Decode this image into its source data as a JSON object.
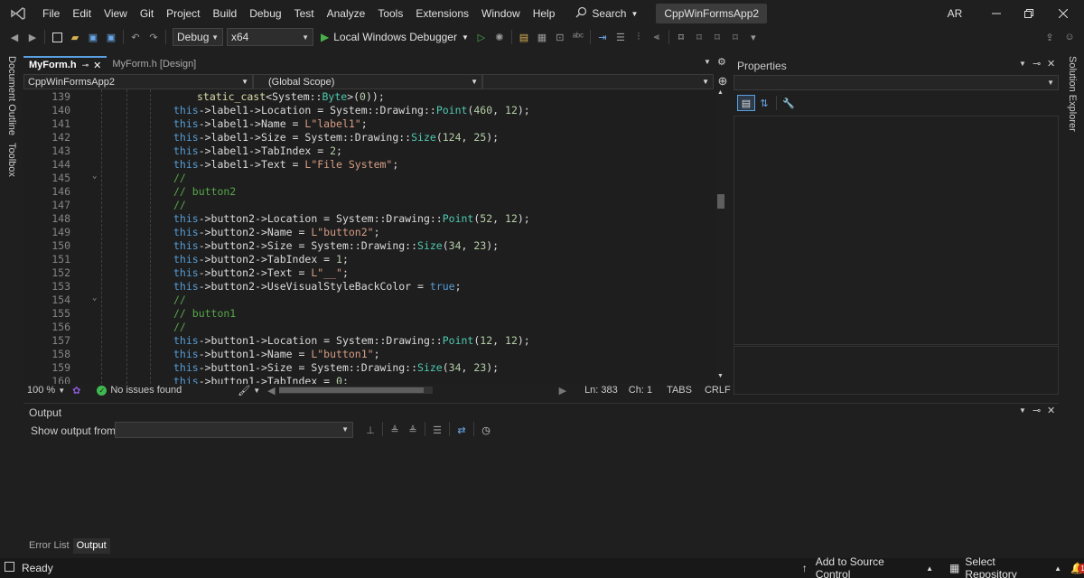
{
  "window": {
    "project_name": "CppWinFormsApp2",
    "avatar_initials": "AR"
  },
  "menu": [
    "File",
    "Edit",
    "View",
    "Git",
    "Project",
    "Build",
    "Debug",
    "Test",
    "Analyze",
    "Tools",
    "Extensions",
    "Window",
    "Help"
  ],
  "search": {
    "label": "Search"
  },
  "toolbar": {
    "config": "Debug",
    "platform": "x64",
    "debugger": "Local Windows Debugger"
  },
  "leftbar": {
    "document_outline": "Document Outline",
    "toolbox": "Toolbox"
  },
  "rightbar": {
    "solution_explorer": "Solution Explorer"
  },
  "editor": {
    "tabs": [
      "MyForm.h",
      "MyForm.h [Design]"
    ],
    "active_tab_pin": "ꟼ",
    "nav_project": "CppWinFormsApp2",
    "nav_scope": "(Global Scope)",
    "lines": [
      {
        "n": "139",
        "indent": 1,
        "t": [
          [
            "fn",
            "static_cast"
          ],
          [
            "id",
            "<System::"
          ],
          [
            "ty",
            "Byte"
          ],
          [
            "id",
            ">("
          ],
          [
            "num",
            "0"
          ],
          [
            "id",
            "));"
          ]
        ]
      },
      {
        "n": "140",
        "t": [
          [
            "kw",
            "this"
          ],
          [
            "id",
            "->label1->Location = System::Drawing::"
          ],
          [
            "ty",
            "Point"
          ],
          [
            "id",
            "("
          ],
          [
            "num",
            "460"
          ],
          [
            "id",
            ", "
          ],
          [
            "num",
            "12"
          ],
          [
            "id",
            ");"
          ]
        ]
      },
      {
        "n": "141",
        "t": [
          [
            "kw",
            "this"
          ],
          [
            "id",
            "->label1->Name = "
          ],
          [
            "str",
            "L\"label1\""
          ],
          [
            "id",
            ";"
          ]
        ]
      },
      {
        "n": "142",
        "t": [
          [
            "kw",
            "this"
          ],
          [
            "id",
            "->label1->Size = System::Drawing::"
          ],
          [
            "ty",
            "Size"
          ],
          [
            "id",
            "("
          ],
          [
            "num",
            "124"
          ],
          [
            "id",
            ", "
          ],
          [
            "num",
            "25"
          ],
          [
            "id",
            ");"
          ]
        ]
      },
      {
        "n": "143",
        "t": [
          [
            "kw",
            "this"
          ],
          [
            "id",
            "->label1->TabIndex = "
          ],
          [
            "num",
            "2"
          ],
          [
            "id",
            ";"
          ]
        ]
      },
      {
        "n": "144",
        "t": [
          [
            "kw",
            "this"
          ],
          [
            "id",
            "->label1->Text = "
          ],
          [
            "str",
            "L\"File System\""
          ],
          [
            "id",
            ";"
          ]
        ]
      },
      {
        "n": "145",
        "t": [
          [
            "cm",
            "//"
          ]
        ]
      },
      {
        "n": "146",
        "t": [
          [
            "cm",
            "// button2"
          ]
        ]
      },
      {
        "n": "147",
        "t": [
          [
            "cm",
            "//"
          ]
        ]
      },
      {
        "n": "148",
        "t": [
          [
            "kw",
            "this"
          ],
          [
            "id",
            "->button2->Location = System::Drawing::"
          ],
          [
            "ty",
            "Point"
          ],
          [
            "id",
            "("
          ],
          [
            "num",
            "52"
          ],
          [
            "id",
            ", "
          ],
          [
            "num",
            "12"
          ],
          [
            "id",
            ");"
          ]
        ]
      },
      {
        "n": "149",
        "t": [
          [
            "kw",
            "this"
          ],
          [
            "id",
            "->button2->Name = "
          ],
          [
            "str",
            "L\"button2\""
          ],
          [
            "id",
            ";"
          ]
        ]
      },
      {
        "n": "150",
        "t": [
          [
            "kw",
            "this"
          ],
          [
            "id",
            "->button2->Size = System::Drawing::"
          ],
          [
            "ty",
            "Size"
          ],
          [
            "id",
            "("
          ],
          [
            "num",
            "34"
          ],
          [
            "id",
            ", "
          ],
          [
            "num",
            "23"
          ],
          [
            "id",
            ");"
          ]
        ]
      },
      {
        "n": "151",
        "t": [
          [
            "kw",
            "this"
          ],
          [
            "id",
            "->button2->TabIndex = "
          ],
          [
            "num",
            "1"
          ],
          [
            "id",
            ";"
          ]
        ]
      },
      {
        "n": "152",
        "t": [
          [
            "kw",
            "this"
          ],
          [
            "id",
            "->button2->Text = "
          ],
          [
            "str",
            "L\"__\""
          ],
          [
            "id",
            ";"
          ]
        ]
      },
      {
        "n": "153",
        "t": [
          [
            "kw",
            "this"
          ],
          [
            "id",
            "->button2->UseVisualStyleBackColor = "
          ],
          [
            "kw",
            "true"
          ],
          [
            "id",
            ";"
          ]
        ]
      },
      {
        "n": "154",
        "t": [
          [
            "cm",
            "//"
          ]
        ]
      },
      {
        "n": "155",
        "t": [
          [
            "cm",
            "// button1"
          ]
        ]
      },
      {
        "n": "156",
        "t": [
          [
            "cm",
            "//"
          ]
        ]
      },
      {
        "n": "157",
        "t": [
          [
            "kw",
            "this"
          ],
          [
            "id",
            "->button1->Location = System::Drawing::"
          ],
          [
            "ty",
            "Point"
          ],
          [
            "id",
            "("
          ],
          [
            "num",
            "12"
          ],
          [
            "id",
            ", "
          ],
          [
            "num",
            "12"
          ],
          [
            "id",
            ");"
          ]
        ]
      },
      {
        "n": "158",
        "t": [
          [
            "kw",
            "this"
          ],
          [
            "id",
            "->button1->Name = "
          ],
          [
            "str",
            "L\"button1\""
          ],
          [
            "id",
            ";"
          ]
        ]
      },
      {
        "n": "159",
        "t": [
          [
            "kw",
            "this"
          ],
          [
            "id",
            "->button1->Size = System::Drawing::"
          ],
          [
            "ty",
            "Size"
          ],
          [
            "id",
            "("
          ],
          [
            "num",
            "34"
          ],
          [
            "id",
            ", "
          ],
          [
            "num",
            "23"
          ],
          [
            "id",
            ");"
          ]
        ]
      },
      {
        "n": "160",
        "t": [
          [
            "kw",
            "this"
          ],
          [
            "id",
            "->button1->TabIndex = "
          ],
          [
            "num",
            "0"
          ],
          [
            "id",
            ";"
          ]
        ]
      }
    ],
    "status": {
      "zoom": "100 %",
      "issues": "No issues found",
      "line": "Ln: 383",
      "col": "Ch: 1",
      "tabs": "TABS",
      "eol": "CRLF"
    }
  },
  "properties": {
    "title": "Properties"
  },
  "output": {
    "title": "Output",
    "show_from_label": "Show output from:"
  },
  "bottom_tabs": [
    "Error List",
    "Output"
  ],
  "statusbar": {
    "ready": "Ready",
    "source_control": "Add to Source Control",
    "select_repo": "Select Repository",
    "notif_count": "1"
  },
  "colors": {
    "accent": "#5aa0e0",
    "play": "#49b049",
    "ok": "#3fb950",
    "vs_purple": "#8a5ad6"
  }
}
